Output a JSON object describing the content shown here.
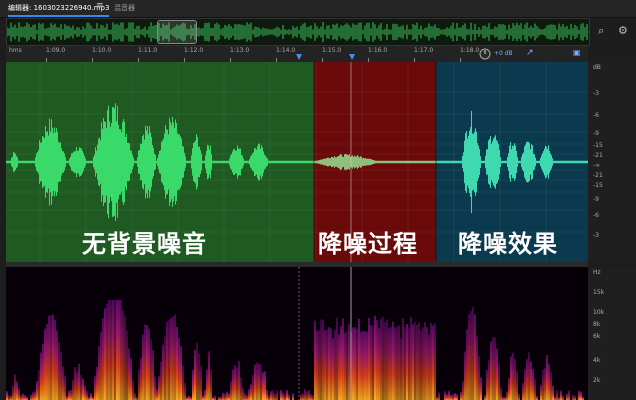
{
  "tabs": {
    "editor": "编辑器: 1603023226940.mp3",
    "menu_glyph": "≡",
    "mixer": "混音器"
  },
  "ruler": {
    "unit": "hms",
    "ticks": [
      "1:09.0",
      "1:10.0",
      "1:11.0",
      "1:12.0",
      "1:13.0",
      "1:14.0",
      "1:15.0",
      "1:16.0",
      "1:17.0",
      "1:18.0"
    ],
    "volume": "+0 dB"
  },
  "panels": [
    {
      "label": "无背景噪音",
      "color": "#1e5a22"
    },
    {
      "label": "降噪过程",
      "color": "#6a0a0a"
    },
    {
      "label": "降噪效果",
      "color": "#0b3a4e"
    }
  ],
  "db_scale": {
    "unit": "dB",
    "labels": [
      "-3",
      "-6",
      "-9",
      "-15",
      "-21",
      "-∞",
      "-21",
      "-15",
      "-9",
      "-6",
      "-3"
    ]
  },
  "hz_scale": {
    "unit": "Hz",
    "labels": [
      "15k",
      "10k",
      "8k",
      "6k",
      "4k",
      "2k"
    ]
  },
  "colors": {
    "waveform": "#39d96a",
    "waveform_noise": "#8fbf7a",
    "waveform_result": "#3fd9b0"
  },
  "icons": [
    "zoom-icon",
    "volume-knob-icon",
    "snap-icon",
    "lock-icon",
    "scroll-icon"
  ]
}
